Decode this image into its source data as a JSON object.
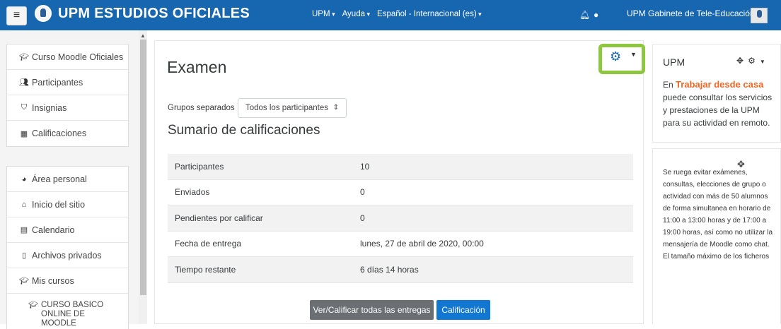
{
  "navbar": {
    "brand": "UPM ESTUDIOS OFICIALES",
    "menu": [
      "UPM",
      "Ayuda",
      "Español - Internacional (es)"
    ],
    "user_name": "UPM Gabinete de Tele-Educación",
    "bar_color": "#1766b0"
  },
  "sidebar": {
    "block1": [
      {
        "icon": "graduation-cap-icon",
        "label": "Curso Moodle Oficiales"
      },
      {
        "icon": "users-icon",
        "label": "Participantes"
      },
      {
        "icon": "shield-icon",
        "label": "Insignias"
      },
      {
        "icon": "table-icon",
        "label": "Calificaciones"
      }
    ],
    "block2": [
      {
        "icon": "dashboard-icon",
        "label": "Área personal"
      },
      {
        "icon": "home-icon",
        "label": "Inicio del sitio"
      },
      {
        "icon": "calendar-icon",
        "label": "Calendario"
      },
      {
        "icon": "file-icon",
        "label": "Archivos privados"
      },
      {
        "icon": "graduation-cap-icon",
        "label": "Mis cursos"
      }
    ],
    "course": "CURSO BASICO ONLINE DE MOODLE"
  },
  "main": {
    "title": "Examen",
    "group_label": "Grupos separados",
    "group_select": "Todos los participantes",
    "summary_heading": "Sumario de calificaciones",
    "rows": [
      {
        "label": "Participantes",
        "value": "10"
      },
      {
        "label": "Enviados",
        "value": "0"
      },
      {
        "label": "Pendientes por calificar",
        "value": "0"
      },
      {
        "label": "Fecha de entrega",
        "value": "lunes, 27 de abril de 2020, 00:00"
      },
      {
        "label": "Tiempo restante",
        "value": "6 días 14 horas"
      }
    ],
    "btn_view_all": "Ver/Calificar todas las entregas",
    "btn_grade": "Calificación",
    "highlight_color": "#8dc63f"
  },
  "right": {
    "block_title": "UPM",
    "intro_prefix": "En",
    "intro_link": "Trabajar desde casa",
    "intro_suffix": "puede consultar los servicios y prestaciones de la UPM para su actividad en remoto.",
    "notice": "Se ruega evitar exámenes, consultas, elecciones de grupo o actividad con más de 50 alumnos de forma simultanea en horario de 11:00 a 13:00 horas y de 17:00 a 19:00 horas, así como no utilizar la mensajería de Moodle como chat. El tamaño máximo de los ficheros"
  }
}
